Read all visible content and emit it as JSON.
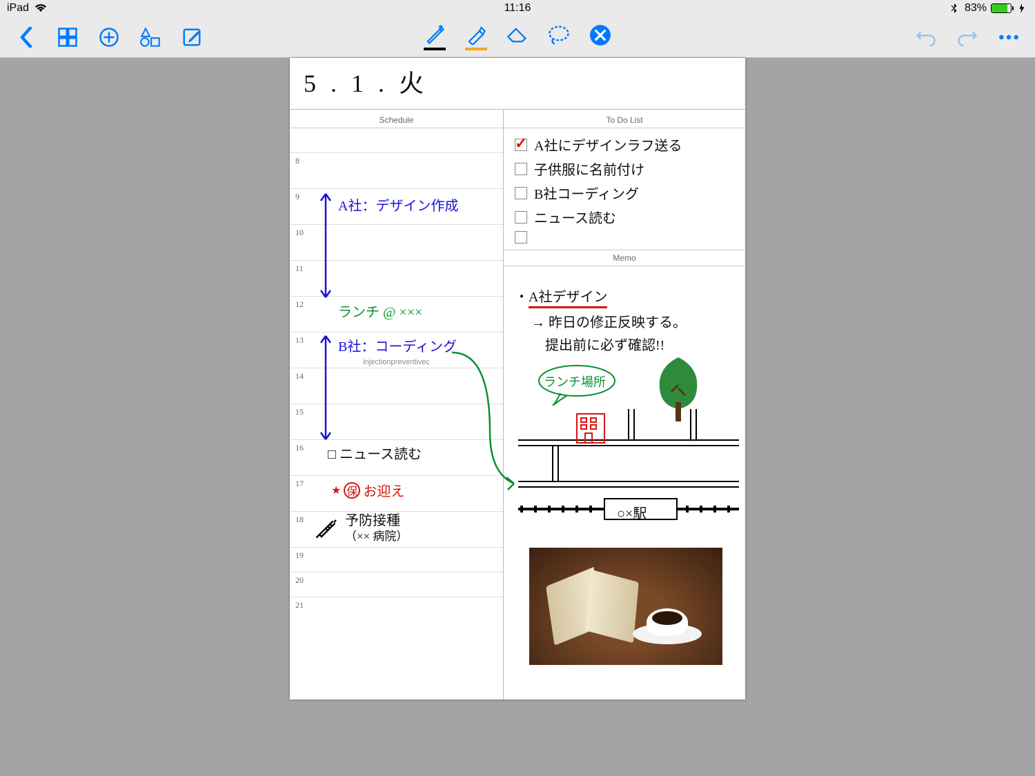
{
  "status": {
    "device": "iPad",
    "time": "11:16",
    "battery_pct": "83%"
  },
  "toolbar": {
    "pen_color": "#000000",
    "highlighter_color": "#f5a623"
  },
  "page": {
    "date_title": "5 . 1 . 火",
    "schedule_label": "Schedule",
    "todo_label": "To Do List",
    "memo_label": "Memo",
    "hours": [
      "8",
      "9",
      "10",
      "11",
      "12",
      "13",
      "14",
      "15",
      "16",
      "17",
      "18",
      "19",
      "20",
      "21"
    ],
    "watermark": "injectionpreventivec",
    "sched_items": {
      "design": "A社：デザイン作成",
      "lunch": "ランチ @ ×××",
      "coding": "B社：コーディング",
      "news": "□ ニュース読む",
      "pickup_star": "★",
      "pickup_ho": "保",
      "pickup": "お迎え",
      "vaccine_l1": "予防接種",
      "vaccine_l2": "（×× 病院）"
    },
    "todo": [
      {
        "label": "A社にデザインラフ送る",
        "checked": true
      },
      {
        "label": "子供服に名前付け",
        "checked": false
      },
      {
        "label": "B社コーディング",
        "checked": false
      },
      {
        "label": "ニュース読む",
        "checked": false
      },
      {
        "label": "",
        "checked": false
      }
    ],
    "memo": {
      "heading": "A社デザイン",
      "line1": "→ 昨日の修正反映する。",
      "line2": "提出前に必ず確認!!",
      "lunch_bubble": "ランチ場所",
      "station": "○×駅"
    }
  }
}
